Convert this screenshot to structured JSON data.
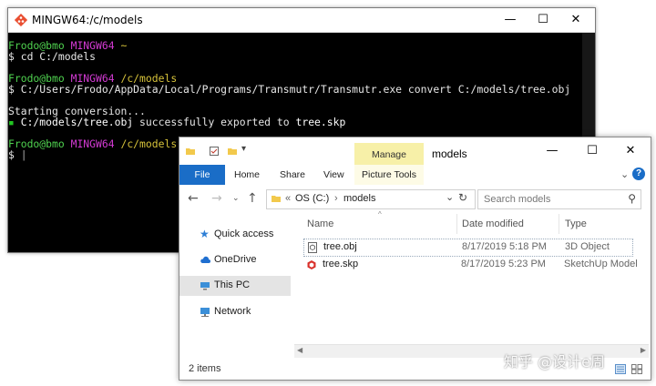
{
  "terminal": {
    "title": "MINGW64:/c/models",
    "controls": {
      "minimize": "—",
      "maximize": "☐",
      "close": "✕"
    },
    "lines": [
      {
        "user": "Frodo@bmo",
        "system": "MINGW64",
        "path": "~"
      },
      {
        "text": "$ cd C:/models"
      },
      {
        "user": "Frodo@bmo",
        "system": "MINGW64",
        "path": "/c/models"
      },
      {
        "text": "$ C:/Users/Frodo/AppData/Local/Programs/Transmutr/Transmutr.exe convert C:/models/tree.obj"
      },
      {
        "text": "Starting conversion..."
      },
      {
        "bullet": "▪",
        "src": "C:/models/tree.obj",
        "msg": " successfully exported to ",
        "dst": "tree.skp"
      },
      {
        "user": "Frodo@bmo",
        "system": "MINGW64",
        "path": "/c/models"
      },
      {
        "prompt": "$"
      }
    ]
  },
  "explorer": {
    "title": "models",
    "manage_tab": "Manage",
    "controls": {
      "minimize": "—",
      "maximize": "☐",
      "close": "✕"
    },
    "ribbon_tabs": {
      "file": "File",
      "home": "Home",
      "share": "Share",
      "view": "View",
      "picture_tools": "Picture Tools"
    },
    "help": "?",
    "address": {
      "prefix": "«",
      "drive": "OS (C:)",
      "sep": "›",
      "folder": "models",
      "dropdown": "⌄"
    },
    "search_placeholder": "Search models",
    "nav_items": [
      "Quick access",
      "OneDrive",
      "This PC",
      "Network"
    ],
    "columns": {
      "name": "Name",
      "date": "Date modified",
      "type": "Type"
    },
    "files": [
      {
        "name": "tree.obj",
        "date": "8/17/2019 5:18 PM",
        "type": "3D Object"
      },
      {
        "name": "tree.skp",
        "date": "8/17/2019 5:23 PM",
        "type": "SketchUp Model"
      }
    ],
    "status": "2 items"
  },
  "watermark": "知乎 @设计e周",
  "colors": {
    "prompt_user": "#4fd24f",
    "prompt_system": "#d33ad3",
    "prompt_path": "#d6c23a",
    "file_tab": "#1a6dc7",
    "manage_tab": "#f7f0a8"
  }
}
